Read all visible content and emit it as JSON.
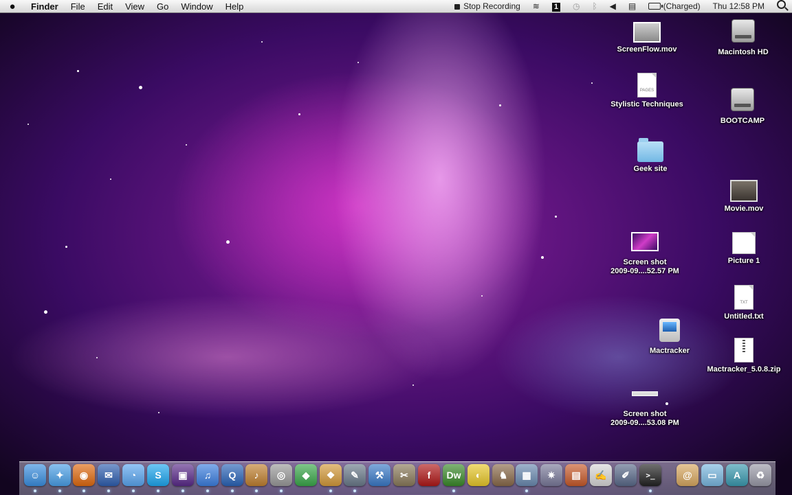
{
  "menubar": {
    "app_name": "Finder",
    "menus": [
      "File",
      "Edit",
      "View",
      "Go",
      "Window",
      "Help"
    ],
    "stop_recording": "Stop Recording",
    "spaces_number": "1",
    "battery_status": "(Charged)",
    "clock": "Thu 12:58 PM"
  },
  "desktop_icons": {
    "screenflow": "ScreenFlow.mov",
    "macintosh_hd": "Macintosh HD",
    "stylistic": "Stylistic Techniques",
    "stylistic_badge": "PAGES",
    "bootcamp": "BOOTCAMP",
    "geek_site": "Geek site",
    "movie": "Movie.mov",
    "screenshot1_line1": "Screen shot",
    "screenshot1_line2": "2009-09....52.57 PM",
    "picture1": "Picture 1",
    "untitled": "Untitled.txt",
    "untitled_badge": "TXT",
    "mactracker": "Mactracker",
    "mactracker_zip": "Mactracker_5.0.8.zip",
    "screenshot2_line1": "Screen shot",
    "screenshot2_line2": "2009-09....53.08 PM"
  },
  "dock": {
    "items": [
      {
        "name": "finder",
        "glyph": "☺",
        "color": "#3a8fe0"
      },
      {
        "name": "safari",
        "glyph": "✦",
        "color": "#4aa0e8"
      },
      {
        "name": "firefox",
        "glyph": "◉",
        "color": "#e06a10"
      },
      {
        "name": "thunderbird",
        "glyph": "✉",
        "color": "#2f5fb0"
      },
      {
        "name": "ichat",
        "glyph": "◔",
        "color": "#5aa6f0"
      },
      {
        "name": "skype",
        "glyph": "S",
        "color": "#1ea7ef"
      },
      {
        "name": "screenflow",
        "glyph": "▣",
        "color": "#5a2a8a"
      },
      {
        "name": "itunes",
        "glyph": "♫",
        "color": "#3c7fe0"
      },
      {
        "name": "quicktime",
        "glyph": "Q",
        "color": "#2a64b8"
      },
      {
        "name": "garageband",
        "glyph": "♪",
        "color": "#c08030"
      },
      {
        "name": "dvd-player",
        "glyph": "◎",
        "color": "#9a9a9a"
      },
      {
        "name": "sims",
        "glyph": "◆",
        "color": "#3aa84a"
      },
      {
        "name": "preview",
        "glyph": "❖",
        "color": "#d49a3a"
      },
      {
        "name": "photo-booth",
        "glyph": "✎",
        "color": "#6a7a8a"
      },
      {
        "name": "xcode",
        "glyph": "⚒",
        "color": "#3a7ac8"
      },
      {
        "name": "gimp",
        "glyph": "✂",
        "color": "#8a7a5a"
      },
      {
        "name": "flash",
        "glyph": "f",
        "color": "#b01818"
      },
      {
        "name": "dreamweaver",
        "glyph": "Dw",
        "color": "#3a8a2a"
      },
      {
        "name": "cyberduck",
        "glyph": "◐",
        "color": "#e8c82a"
      },
      {
        "name": "chess",
        "glyph": "♞",
        "color": "#8a6a4a"
      },
      {
        "name": "iphoto",
        "glyph": "▦",
        "color": "#6a8ab0"
      },
      {
        "name": "imovie",
        "glyph": "✷",
        "color": "#7a7a9a"
      },
      {
        "name": "keynote",
        "glyph": "▤",
        "color": "#c85a2a"
      },
      {
        "name": "textedit",
        "glyph": "✍",
        "color": "#d8d8d8"
      },
      {
        "name": "script-editor",
        "glyph": "✐",
        "color": "#5a6a8a"
      },
      {
        "name": "terminal",
        "glyph": ">_",
        "color": "#222222"
      },
      {
        "name": "mail-folder",
        "glyph": "@",
        "color": "#d8a860"
      },
      {
        "name": "documents-folder",
        "glyph": "▭",
        "color": "#7ab8e0"
      },
      {
        "name": "applications-folder",
        "glyph": "A",
        "color": "#3a9ab0"
      },
      {
        "name": "trash",
        "glyph": "♻",
        "color": "#9a9aa8"
      }
    ]
  }
}
